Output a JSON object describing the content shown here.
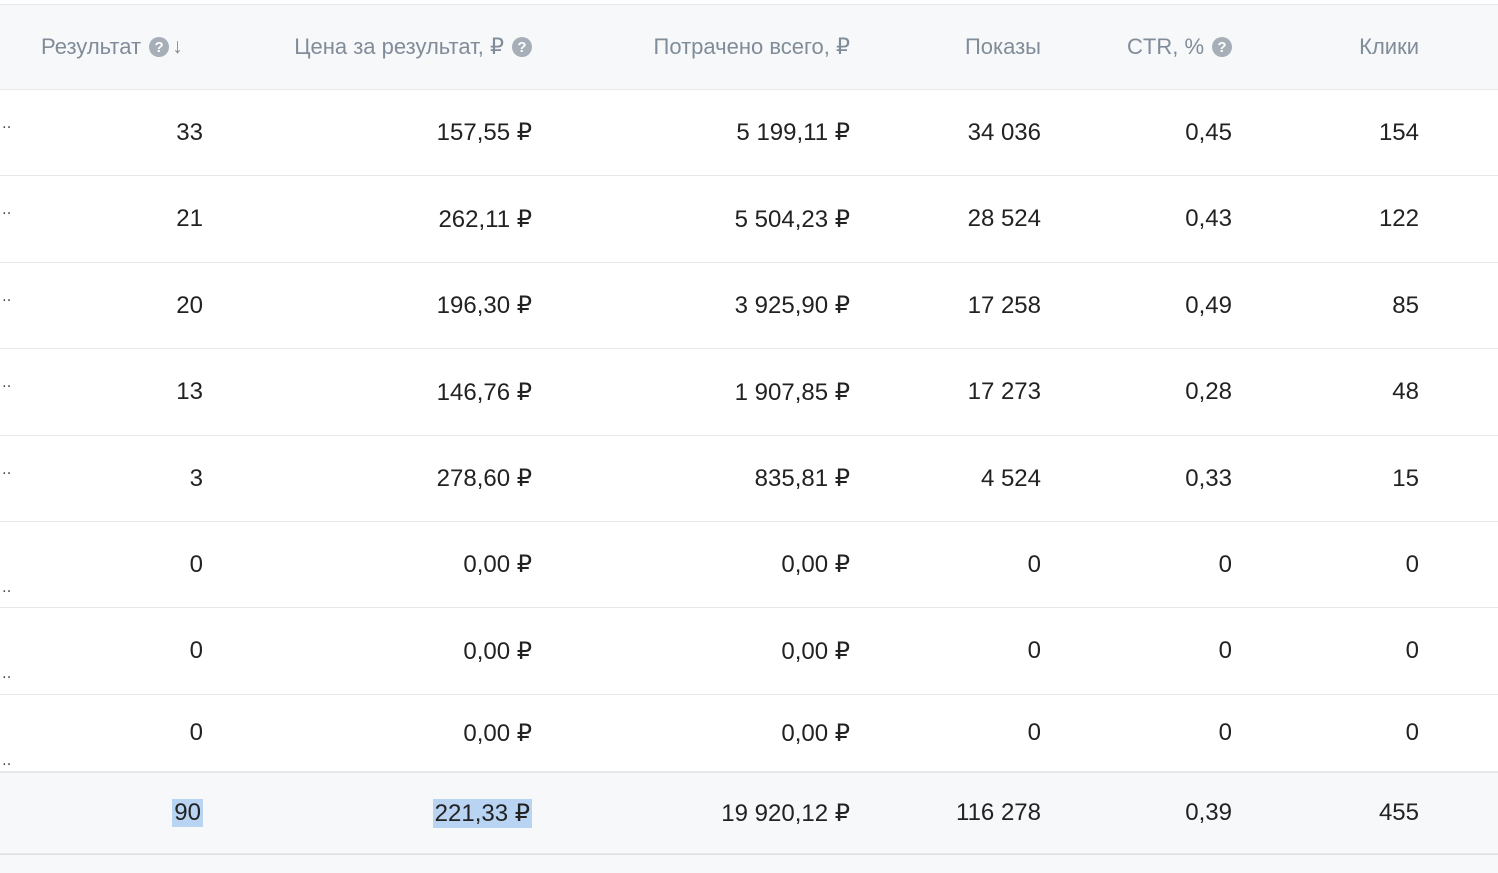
{
  "columns": {
    "result": "Результат",
    "price": "Цена за результат, ₽",
    "spent": "Потрачено всего, ₽",
    "shows": "Показы",
    "ctr": "CTR, %",
    "clicks": "Клики"
  },
  "icons": {
    "help": "question-circle-icon",
    "sort": "sort-down-arrow-icon",
    "help_glyph": "?",
    "sort_glyph": "↓"
  },
  "row_marker": "‥",
  "rows": [
    {
      "result": "33",
      "price": "157,55 ₽",
      "spent": "5 199,11 ₽",
      "shows": "34 036",
      "ctr": "0,45",
      "clicks": "154"
    },
    {
      "result": "21",
      "price": "262,11 ₽",
      "spent": "5 504,23 ₽",
      "shows": "28 524",
      "ctr": "0,43",
      "clicks": "122"
    },
    {
      "result": "20",
      "price": "196,30 ₽",
      "spent": "3 925,90 ₽",
      "shows": "17 258",
      "ctr": "0,49",
      "clicks": "85"
    },
    {
      "result": "13",
      "price": "146,76 ₽",
      "spent": "1 907,85 ₽",
      "shows": "17 273",
      "ctr": "0,28",
      "clicks": "48"
    },
    {
      "result": "3",
      "price": "278,60 ₽",
      "spent": "835,81 ₽",
      "shows": "4 524",
      "ctr": "0,33",
      "clicks": "15"
    },
    {
      "result": "0",
      "price": "0,00 ₽",
      "spent": "0,00 ₽",
      "shows": "0",
      "ctr": "0",
      "clicks": "0"
    },
    {
      "result": "0",
      "price": "0,00 ₽",
      "spent": "0,00 ₽",
      "shows": "0",
      "ctr": "0",
      "clicks": "0"
    },
    {
      "result": "0",
      "price": "0,00 ₽",
      "spent": "0,00 ₽",
      "shows": "0",
      "ctr": "0",
      "clicks": "0"
    }
  ],
  "totals": {
    "result": "90",
    "price": "221,33 ₽",
    "spent": "19 920,12 ₽",
    "shows": "116 278",
    "ctr": "0,39",
    "clicks": "455"
  },
  "colors": {
    "header_bg": "#f7f8fa",
    "header_text": "#818c99",
    "selection": "#b9d3f3",
    "border": "#e7e8ec"
  }
}
